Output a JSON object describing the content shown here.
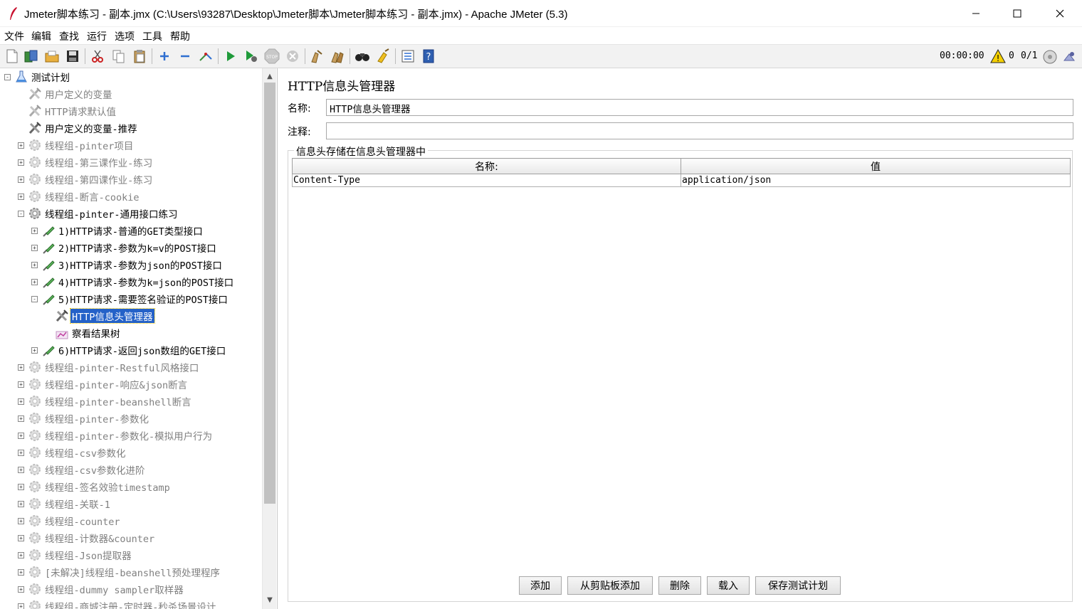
{
  "window": {
    "title": "Jmeter脚本练习 - 副本.jmx (C:\\Users\\93287\\Desktop\\Jmeter脚本\\Jmeter脚本练习 - 副本.jmx) - Apache JMeter (5.3)"
  },
  "menu": [
    "文件",
    "编辑",
    "查找",
    "运行",
    "选项",
    "工具",
    "帮助"
  ],
  "toolbar": {
    "buttons": [
      "new-icon",
      "templates-icon",
      "open-icon",
      "save-icon",
      "cut-icon",
      "copy-icon",
      "paste-icon",
      "expand-icon",
      "collapse-icon",
      "toggle-icon",
      "start-icon",
      "start-no-pause-icon",
      "stop-icon",
      "shutdown-icon",
      "clear-icon",
      "clear-all-icon",
      "search-icon",
      "reset-search-icon",
      "function-helper-icon",
      "help-icon"
    ],
    "timer": "00:00:00",
    "warnings": "0",
    "threads": "0/1"
  },
  "tree": [
    {
      "label": "测试计划",
      "level": 0,
      "icon": "test-plan-icon",
      "expand": "-",
      "state": "normal"
    },
    {
      "label": "用户定义的变量",
      "level": 1,
      "icon": "config-icon",
      "expand": "",
      "state": "disabled"
    },
    {
      "label": "HTTP请求默认值",
      "level": 1,
      "icon": "config-icon",
      "expand": "",
      "state": "disabled"
    },
    {
      "label": "用户定义的变量-推荐",
      "level": 1,
      "icon": "config-icon",
      "expand": "",
      "state": "normal"
    },
    {
      "label": "线程组-pinter项目",
      "level": 1,
      "icon": "thread-group-icon",
      "expand": "+",
      "state": "disabled"
    },
    {
      "label": "线程组-第三课作业-练习",
      "level": 1,
      "icon": "thread-group-icon",
      "expand": "+",
      "state": "disabled"
    },
    {
      "label": "线程组-第四课作业-练习",
      "level": 1,
      "icon": "thread-group-icon",
      "expand": "+",
      "state": "disabled"
    },
    {
      "label": "线程组-断言-cookie",
      "level": 1,
      "icon": "thread-group-icon",
      "expand": "+",
      "state": "disabled"
    },
    {
      "label": "线程组-pinter-通用接口练习",
      "level": 1,
      "icon": "thread-group-icon",
      "expand": "-",
      "state": "normal"
    },
    {
      "label": "1)HTTP请求-普通的GET类型接口",
      "level": 2,
      "icon": "sampler-icon",
      "expand": "+",
      "state": "normal"
    },
    {
      "label": "2)HTTP请求-参数为k=v的POST接口",
      "level": 2,
      "icon": "sampler-icon",
      "expand": "+",
      "state": "normal"
    },
    {
      "label": "3)HTTP请求-参数为json的POST接口",
      "level": 2,
      "icon": "sampler-icon",
      "expand": "+",
      "state": "normal"
    },
    {
      "label": "4)HTTP请求-参数为k=json的POST接口",
      "level": 2,
      "icon": "sampler-icon",
      "expand": "+",
      "state": "normal"
    },
    {
      "label": "5)HTTP请求-需要签名验证的POST接口",
      "level": 2,
      "icon": "sampler-icon",
      "expand": "-",
      "state": "normal"
    },
    {
      "label": "HTTP信息头管理器",
      "level": 3,
      "icon": "config-icon",
      "expand": "",
      "state": "selected"
    },
    {
      "label": "察看结果树",
      "level": 3,
      "icon": "listener-icon",
      "expand": "",
      "state": "normal"
    },
    {
      "label": "6)HTTP请求-返回json数组的GET接口",
      "level": 2,
      "icon": "sampler-icon",
      "expand": "+",
      "state": "normal"
    },
    {
      "label": "线程组-pinter-Restful风格接口",
      "level": 1,
      "icon": "thread-group-icon",
      "expand": "+",
      "state": "disabled"
    },
    {
      "label": "线程组-pinter-响应&json断言",
      "level": 1,
      "icon": "thread-group-icon",
      "expand": "+",
      "state": "disabled"
    },
    {
      "label": "线程组-pinter-beanshell断言",
      "level": 1,
      "icon": "thread-group-icon",
      "expand": "+",
      "state": "disabled"
    },
    {
      "label": "线程组-pinter-参数化",
      "level": 1,
      "icon": "thread-group-icon",
      "expand": "+",
      "state": "disabled"
    },
    {
      "label": "线程组-pinter-参数化-模拟用户行为",
      "level": 1,
      "icon": "thread-group-icon",
      "expand": "+",
      "state": "disabled"
    },
    {
      "label": "线程组-csv参数化",
      "level": 1,
      "icon": "thread-group-icon",
      "expand": "+",
      "state": "disabled"
    },
    {
      "label": "线程组-csv参数化进阶",
      "level": 1,
      "icon": "thread-group-icon",
      "expand": "+",
      "state": "disabled"
    },
    {
      "label": "线程组-签名效验timestamp",
      "level": 1,
      "icon": "thread-group-icon",
      "expand": "+",
      "state": "disabled"
    },
    {
      "label": "线程组-关联-1",
      "level": 1,
      "icon": "thread-group-icon",
      "expand": "+",
      "state": "disabled"
    },
    {
      "label": "线程组-counter",
      "level": 1,
      "icon": "thread-group-icon",
      "expand": "+",
      "state": "disabled"
    },
    {
      "label": "线程组-计数器&counter",
      "level": 1,
      "icon": "thread-group-icon",
      "expand": "+",
      "state": "disabled"
    },
    {
      "label": "线程组-Json提取器",
      "level": 1,
      "icon": "thread-group-icon",
      "expand": "+",
      "state": "disabled"
    },
    {
      "label": "[未解决]线程组-beanshell预处理程序",
      "level": 1,
      "icon": "thread-group-icon",
      "expand": "+",
      "state": "disabled"
    },
    {
      "label": "线程组-dummy sampler取样器",
      "level": 1,
      "icon": "thread-group-icon",
      "expand": "+",
      "state": "disabled"
    },
    {
      "label": "线程组-商城注册-定时器-秒杀场景设计",
      "level": 1,
      "icon": "thread-group-icon",
      "expand": "+",
      "state": "disabled"
    }
  ],
  "panel": {
    "title": "HTTP信息头管理器",
    "name_label": "名称:",
    "name_value": "HTTP信息头管理器",
    "comment_label": "注释:",
    "comment_value": "",
    "group_title": "信息头存储在信息头管理器中",
    "columns": [
      "名称:",
      "值"
    ],
    "rows": [
      [
        "Content-Type",
        "application/json"
      ]
    ],
    "buttons": [
      "添加",
      "从剪贴板添加",
      "删除",
      "载入",
      "保存测试计划"
    ]
  }
}
